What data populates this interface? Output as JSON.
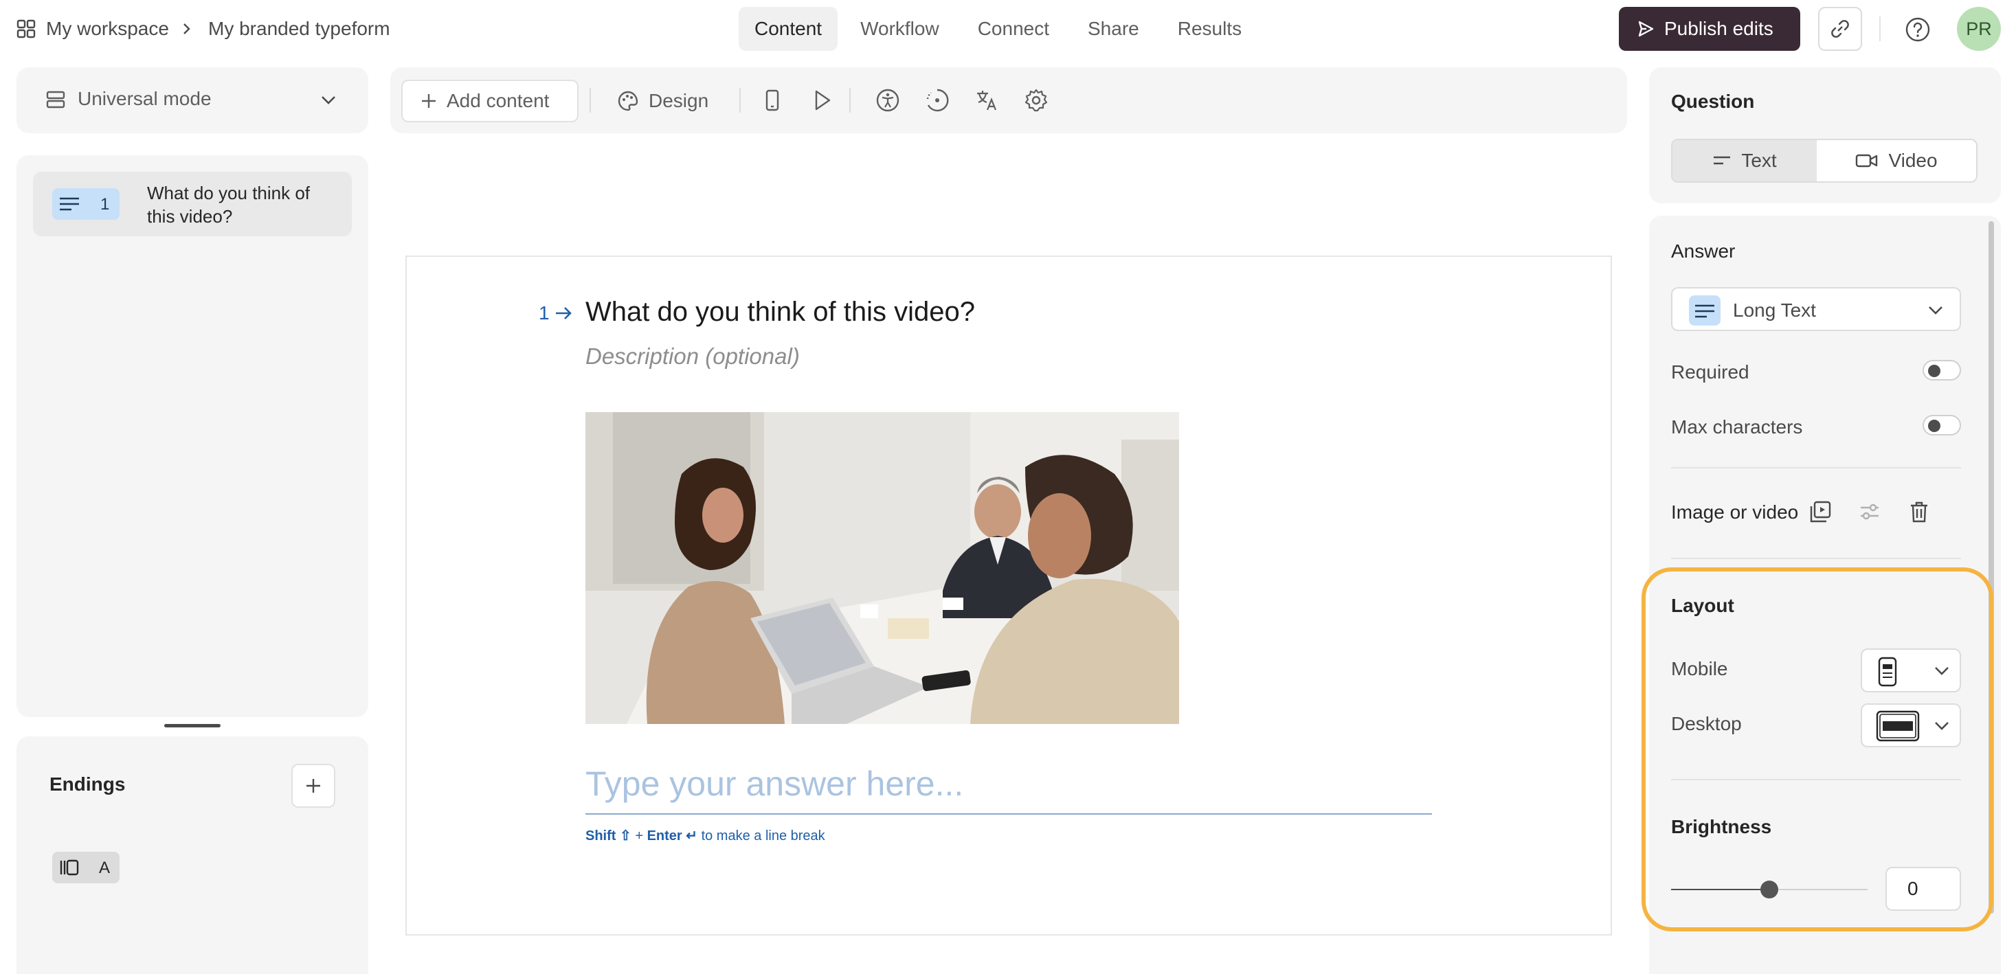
{
  "header": {
    "workspace": "My workspace",
    "form_name": "My branded typeform",
    "tabs": [
      {
        "label": "Content",
        "active": true
      },
      {
        "label": "Workflow",
        "active": false
      },
      {
        "label": "Connect",
        "active": false
      },
      {
        "label": "Share",
        "active": false
      },
      {
        "label": "Results",
        "active": false
      }
    ],
    "publish_label": "Publish edits",
    "avatar_initials": "PR"
  },
  "left_panel": {
    "mode_label": "Universal mode",
    "questions": [
      {
        "number": "1",
        "text": "What do you think of this video?",
        "type_icon": "long-text-icon"
      }
    ],
    "endings_title": "Endings",
    "endings": [
      {
        "letter": "A",
        "icon": "ending-screen-icon"
      }
    ]
  },
  "toolbar": {
    "add_content_label": "Add content",
    "design_label": "Design",
    "icons": [
      "mobile-preview-icon",
      "play-preview-icon",
      "accessibility-icon",
      "progress-icon",
      "translate-icon",
      "settings-icon"
    ]
  },
  "canvas": {
    "question_number": "1",
    "question_title": "What do you think of this video?",
    "description_placeholder": "Description (optional)",
    "answer_placeholder": "Type your answer here...",
    "hint": {
      "shift": "Shift ⇧",
      "plus": "+",
      "enter": "Enter ↵",
      "rest": "to make a line break"
    }
  },
  "right_panel": {
    "question_section": "Question",
    "question_modes": [
      {
        "label": "Text",
        "selected": true
      },
      {
        "label": "Video",
        "selected": false
      }
    ],
    "answer_section": "Answer",
    "answer_type": "Long Text",
    "required_label": "Required",
    "required_on": false,
    "max_chars_label": "Max characters",
    "max_chars_on": false,
    "media_label": "Image or video",
    "layout_section": "Layout",
    "mobile_label": "Mobile",
    "desktop_label": "Desktop",
    "brightness_section": "Brightness",
    "brightness_value": "0",
    "brightness_slider_fraction": 0.5
  },
  "colors": {
    "accent_blue": "#1f5fa8",
    "publish_bg": "#3a2a35",
    "highlight": "#f5b440",
    "badge_blue": "#c6e0fa",
    "avatar_bg": "#b9dfb4"
  }
}
